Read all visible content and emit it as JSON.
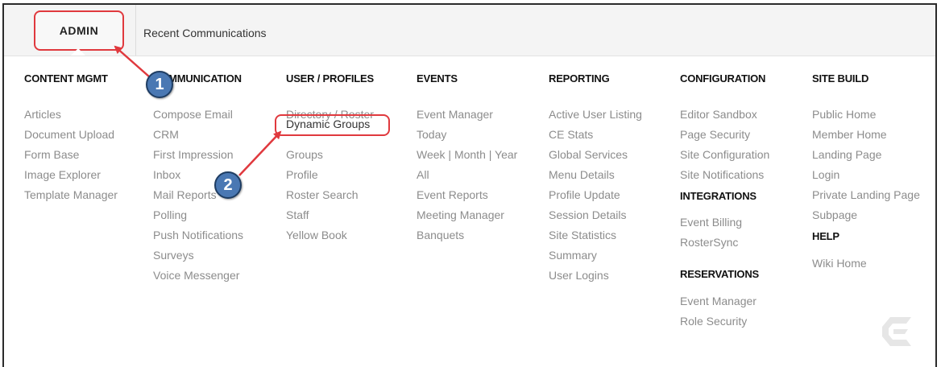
{
  "topbar": {
    "admin_label": "ADMIN",
    "recent_label": "Recent Communications"
  },
  "columns": [
    {
      "heading": "CONTENT MGMT",
      "items": [
        "Articles",
        "Document Upload",
        "Form Base",
        "Image Explorer",
        "Template Manager"
      ]
    },
    {
      "heading": "COMMUNICATION",
      "items": [
        "Compose Email",
        "CRM",
        "First Impression",
        "Inbox",
        "Mail Reports",
        "Polling",
        "Push Notifications",
        "Surveys",
        "Voice Messenger"
      ]
    },
    {
      "heading": "USER / PROFILES",
      "items": [
        "Directory / Roster",
        "Dynamic Groups",
        "Groups",
        "Profile",
        "Roster Search",
        "Staff",
        "Yellow Book"
      ]
    },
    {
      "heading": "EVENTS",
      "items": [
        "Event Manager",
        "Today",
        "Week | Month | Year",
        "All",
        "Event Reports",
        "Meeting Manager",
        "Banquets"
      ]
    },
    {
      "heading": "REPORTING",
      "items": [
        "Active User Listing",
        "CE Stats",
        "Global Services",
        "Menu Details",
        "Profile Update",
        "Session Details",
        "Site Statistics",
        "Summary",
        "User Logins"
      ]
    },
    {
      "heading": "CONFIGURATION",
      "items": [
        "Editor Sandbox",
        "Page Security",
        "Site Configuration",
        "Site Notifications"
      ]
    },
    {
      "heading": "SITE BUILD",
      "items": [
        "Public Home",
        "Member Home",
        "Landing Page",
        "Login",
        "Private Landing Page",
        "Subpage"
      ]
    }
  ],
  "integrations": {
    "heading": "INTEGRATIONS",
    "items": [
      "Event Billing",
      "RosterSync"
    ]
  },
  "reservations": {
    "heading": "RESERVATIONS",
    "items": [
      "Event Manager",
      "Role Security"
    ]
  },
  "help": {
    "heading": "HELP",
    "items": [
      "Wiki Home"
    ]
  },
  "callouts": {
    "step1": "1",
    "step2": "2"
  },
  "colors": {
    "highlight": "#e0393e",
    "badge": "#4a78b3",
    "text_muted": "#8c8c8c"
  },
  "icons": {
    "brand_logo": "brand-logo-icon"
  }
}
